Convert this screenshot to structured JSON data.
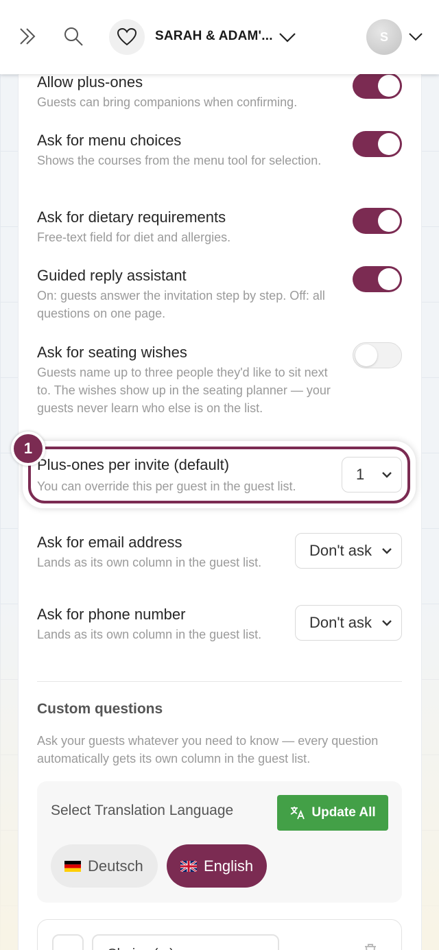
{
  "header": {
    "event_name": "SARAH & ADAM'...",
    "avatar_initial": "S"
  },
  "settings": [
    {
      "title": "Allow plus-ones",
      "desc": "Guests can bring companions when confirming.",
      "enabled": true
    },
    {
      "title": "Ask for menu choices",
      "desc": "Shows the courses from the menu tool for selection.",
      "enabled": true
    },
    {
      "title": "Ask for dietary requirements",
      "desc": "Free-text field for diet and allergies.",
      "enabled": true
    },
    {
      "title": "Guided reply assistant",
      "desc": "On: guests answer the invitation step by step. Off: all questions on one page.",
      "enabled": true
    },
    {
      "title": "Ask for seating wishes",
      "desc": "Guests name up to three people they'd like to sit next to. The wishes show up in the seating planner — your guests never learn who else is on the list.",
      "enabled": false
    }
  ],
  "highlight": {
    "step_number": "1",
    "title": "Plus-ones per invite (default)",
    "desc": "You can override this per guest in the guest list.",
    "value": "1"
  },
  "email": {
    "title": "Ask for email address",
    "desc": "Lands as its own column in the guest list.",
    "value": "Don't ask"
  },
  "phone": {
    "title": "Ask for phone number",
    "desc": "Lands as its own column in the guest list.",
    "value": "Don't ask"
  },
  "custom_questions": {
    "title": "Custom questions",
    "desc": "Ask your guests whatever you need to know — every question automatically gets its own column in the guest list.",
    "translation_label": "Select Translation Language",
    "update_all_label": "Update All",
    "languages": [
      "Deutsch",
      "English"
    ],
    "selected_language": "English",
    "question_input_value": "Choice (...)"
  },
  "colors": {
    "accent": "#7b2b52",
    "update_green": "#43a047"
  }
}
